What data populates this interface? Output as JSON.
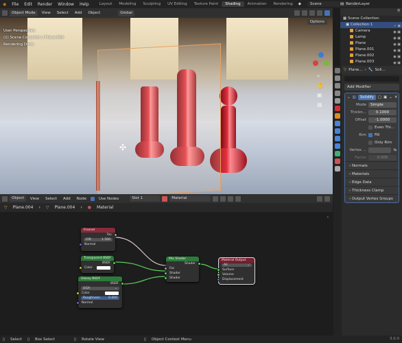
{
  "topbar": {
    "menus": [
      "File",
      "Edit",
      "Render",
      "Window",
      "Help"
    ],
    "tabs": [
      "Layout",
      "Modeling",
      "Sculpting",
      "UV Editing",
      "Texture Paint",
      "Shading",
      "Animation",
      "Rendering"
    ],
    "active_tab": "Shading",
    "scene": "Scene",
    "render_layer": "RenderLayer"
  },
  "viewport": {
    "mode": "Object Mode",
    "menus": [
      "View",
      "Select",
      "Add",
      "Object"
    ],
    "transform": "Global",
    "overlay_lines": [
      "User Perspective",
      "(1) Scene Collection | Plane.004",
      "Rendering Done"
    ],
    "options": "Options"
  },
  "node_header": {
    "editor": "Object",
    "menus": [
      "View",
      "Select",
      "Add",
      "Node"
    ],
    "use_nodes": "Use Nodes",
    "slot": "Slot 1",
    "material": "Material"
  },
  "breadcrumb": [
    "Plane.004",
    "Plane.004",
    "Material"
  ],
  "nodes": {
    "fresnel": {
      "title": "Fresnel",
      "out": "Fac",
      "ior_label": "IOR",
      "ior_value": "1.500",
      "normal": "Normal"
    },
    "transparent": {
      "title": "Transparent BSDF",
      "out": "BSDF",
      "color": "Color"
    },
    "glossy": {
      "title": "Glossy BSDF",
      "out": "BSDF",
      "dist": "GGX",
      "color": "Color",
      "rough_label": "Roughness",
      "rough_value": "0.000",
      "normal": "Normal"
    },
    "mix": {
      "title": "Mix Shader",
      "out": "Shader",
      "fac": "Fac",
      "s1": "Shader",
      "s2": "Shader"
    },
    "output": {
      "title": "Material Output",
      "target": "All",
      "surface": "Surface",
      "volume": "Volume",
      "disp": "Displacement"
    }
  },
  "outliner": {
    "title": "Scene Collection",
    "items": [
      {
        "name": "Collection 1"
      },
      {
        "name": "Camera"
      },
      {
        "name": "Lamp"
      },
      {
        "name": "Plane"
      },
      {
        "name": "Plane.001"
      },
      {
        "name": "Plane.002"
      },
      {
        "name": "Plane.003"
      }
    ]
  },
  "properties": {
    "obj": "Plane...",
    "tab2": "Soli...",
    "add_modifier": "Add Modifier",
    "modifier_name": "Solidify",
    "mode_label": "Mode",
    "mode_value": "Simple",
    "thick_label": "Thickn...",
    "thick_value": "0.1000",
    "offset_label": "Offset",
    "offset_value": "-1.0000",
    "even_label": "Even Thi...",
    "rim_label": "Rim",
    "fill_label": "Fill",
    "only_rim_label": "Only Rim",
    "vertex_label": "Vertex ...",
    "factor_label": "Factor",
    "factor_value": "0.000",
    "sections": [
      "Normals",
      "Materials",
      "Edge Data",
      "Thickness Clamp",
      "Output Vertex Groups"
    ]
  },
  "statusbar": {
    "select": "Select",
    "box_select": "Box Select",
    "rotate": "Rotate View",
    "context": "Object Context Menu",
    "version": "3.0.0"
  },
  "colors": {
    "accent": "#4772b3",
    "shader_green": "#2d7a3a",
    "input_red": "#8a2a3a",
    "output_red": "#7a2030"
  }
}
